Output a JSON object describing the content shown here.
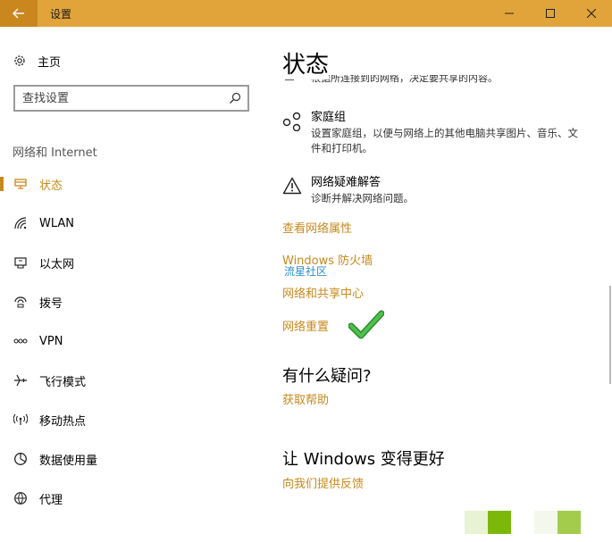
{
  "window": {
    "title": "设置",
    "controls": [
      "minimize-icon",
      "maximize-icon",
      "close-icon"
    ]
  },
  "sidebar": {
    "home_label": "主页",
    "search_placeholder": "查找设置",
    "section_label": "网络和 Internet",
    "items": [
      {
        "label": "状态",
        "icon": "status-icon",
        "active": true
      },
      {
        "label": "WLAN",
        "icon": "wifi-icon",
        "active": false
      },
      {
        "label": "以太网",
        "icon": "ethernet-icon",
        "active": false
      },
      {
        "label": "拨号",
        "icon": "dialup-icon",
        "active": false
      },
      {
        "label": "VPN",
        "icon": "vpn-icon",
        "active": false
      },
      {
        "label": "飞行模式",
        "icon": "airplane-icon",
        "active": false
      },
      {
        "label": "移动热点",
        "icon": "hotspot-icon",
        "active": false
      },
      {
        "label": "数据使用量",
        "icon": "data-usage-icon",
        "active": false
      },
      {
        "label": "代理",
        "icon": "proxy-icon",
        "active": false
      }
    ]
  },
  "main": {
    "title": "状态",
    "clipped_desc": "根据所连接到的网络，决定要共享的内容。",
    "homegroup": {
      "title": "家庭组",
      "desc": "设置家庭组，以便与网络上的其他电脑共享图片、音乐、文件和打印机。"
    },
    "troubleshoot": {
      "title": "网络疑难解答",
      "desc": "诊断并解决网络问题。"
    },
    "links": {
      "view_properties": "查看网络属性",
      "firewall": "Windows 防火墙",
      "sharing_center": "网络和共享中心",
      "reset": "网络重置"
    },
    "watermark": "流星社区",
    "questions_title": "有什么疑问?",
    "get_help": "获取帮助",
    "improve_title": "让 Windows 变得更好",
    "feedback": "向我们提供反馈"
  },
  "colors": {
    "titlebar": "#e0a43a",
    "accent": "#c8891c",
    "check": "#3aa83a",
    "square_light": "#e8f2d4",
    "square_dark": "#7cb80a",
    "square_mid": "#a3cc4c"
  }
}
